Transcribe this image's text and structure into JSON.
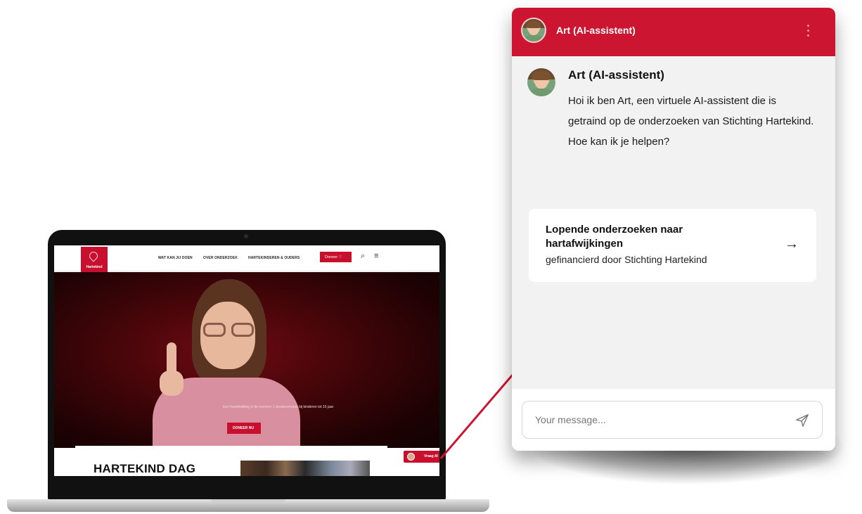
{
  "website": {
    "nav": [
      {
        "label": "WAT KAN JIJ DOEN"
      },
      {
        "label": "OVER ONDERZOEK"
      },
      {
        "label": "HARTEKINDEREN & OUDERS"
      }
    ],
    "logo_text": "Hartekind",
    "donate_label": "Doneer",
    "hero_text": "Een hartafwijking is de nummer 1 doodsoorzaak bij kinderen tot 15 jaar",
    "hero_button": "DONEER NU",
    "section_heading": "HARTEKIND DAG",
    "ask_ai_label": "Vraag AI"
  },
  "chat": {
    "header_title": "Art (AI-assistent)",
    "message": {
      "sender": "Art (AI-assistent)",
      "text": "Hoi ik ben Art, een virtuele AI-assistent die is getraind op de onderzoeken van Stichting Hartekind. Hoe kan ik je helpen?"
    },
    "suggestion": {
      "title": "Lopende onderzoeken naar hartafwijkingen",
      "subtitle": "gefinancierd door Stichting Hartekind",
      "arrow_icon": "arrow-right-icon"
    },
    "composer": {
      "placeholder": "Your message...",
      "send_icon": "send-icon"
    }
  },
  "colors": {
    "brand_red": "#cc1530",
    "chat_bg": "#f2f2f2",
    "card_bg": "#ffffff"
  }
}
